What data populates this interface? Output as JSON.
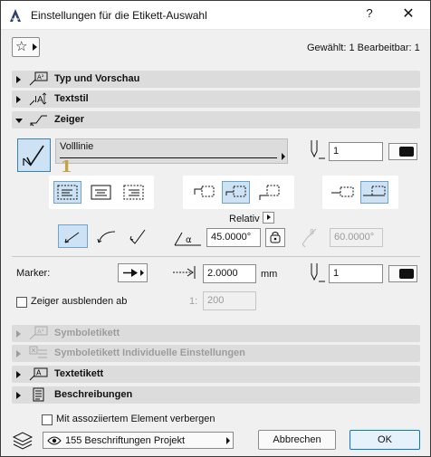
{
  "window": {
    "title": "Einstellungen für die Etikett-Auswahl",
    "help": "?",
    "close": "✕"
  },
  "header": {
    "selection_info": "Gewählt: 1 Bearbeitbar: 1"
  },
  "sections": {
    "typ": {
      "label": "Typ und Vorschau"
    },
    "textstil": {
      "label": "Textstil"
    },
    "zeiger": {
      "label": "Zeiger"
    },
    "symboletikett": {
      "label": "Symboletikett"
    },
    "symbol_individuell": {
      "label": "Symboletikett Individuelle Einstellungen"
    },
    "textetikett": {
      "label": "Textetikett"
    },
    "beschreibungen": {
      "label": "Beschreibungen"
    }
  },
  "zeiger": {
    "line_type": "Volllinie",
    "pen_number": "1",
    "badge": "1",
    "relativ_label": "Relativ",
    "angle_value": "45.0000°",
    "angle2_value": "60.0000°",
    "marker_label": "Marker:",
    "marker_size": "2.0000",
    "marker_unit": "mm",
    "marker_pen": "1",
    "hide_label": "Zeiger ausblenden ab",
    "scale_prefix": "1:",
    "scale_value": "200"
  },
  "footer": {
    "hide_with_element": "Mit assoziiertem Element verbergen",
    "layer": "155 Beschriftungen Projekt",
    "cancel": "Abbrechen",
    "ok": "OK"
  },
  "colors": {
    "accent": "#0078d7",
    "selected_fill": "#cde3f5",
    "badge": "#c8a046"
  }
}
